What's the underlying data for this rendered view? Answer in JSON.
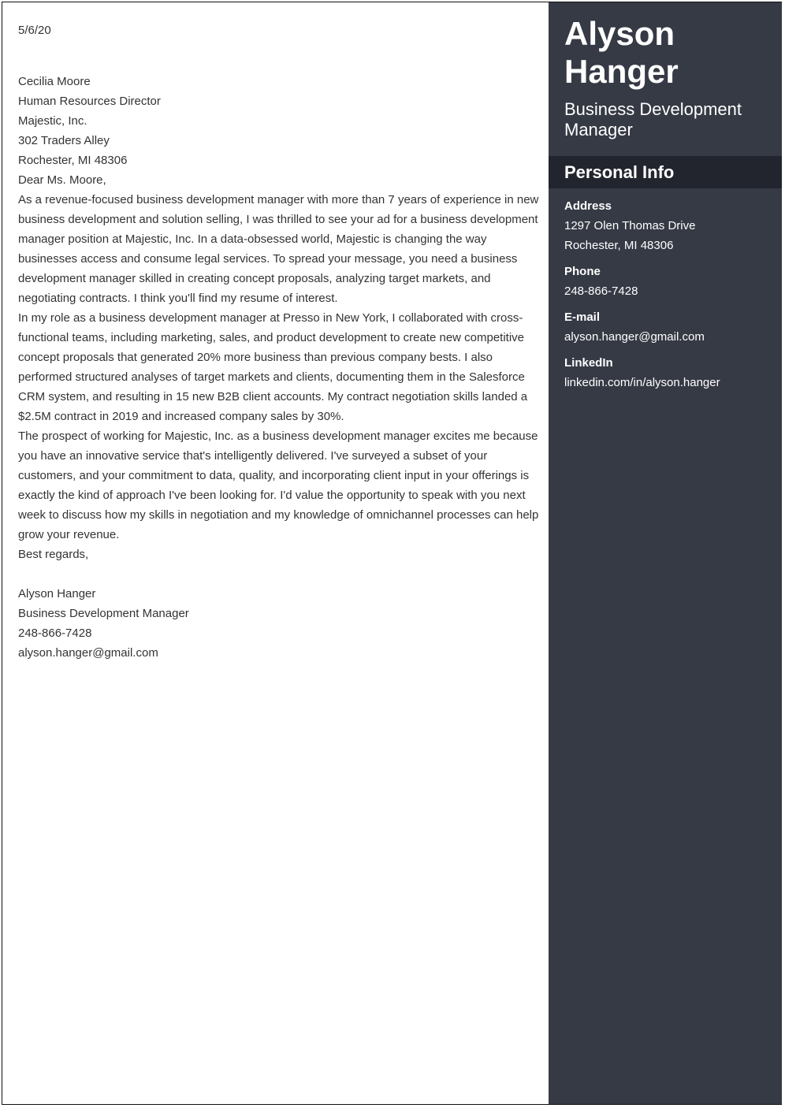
{
  "letter": {
    "date": "5/6/20",
    "recipient": [
      "Cecilia Moore",
      "Human Resources Director",
      "Majestic, Inc.",
      "302 Traders Alley",
      "Rochester, MI 48306"
    ],
    "salutation": "Dear Ms. Moore,",
    "paragraphs": [
      "As a revenue-focused business development manager with more than 7 years of experience in new business development and solution selling, I was thrilled to see your ad for a business development manager position at Majestic, Inc. In a data-obsessed world, Majestic is changing the way businesses access and consume legal services. To spread your message, you need a business development manager skilled in creating concept proposals, analyzing target markets, and negotiating contracts. I think you'll find my resume of interest.",
      "In my role as a business development manager at Presso in New York, I collaborated with cross-functional teams, including marketing, sales, and product development to create new competitive concept proposals that generated 20% more business than previous company bests. I also performed structured analyses of target markets and clients, documenting them in the Salesforce CRM system, and resulting in 15 new B2B client accounts. My contract negotiation skills landed a $2.5M contract in 2019 and increased company sales by 30%.",
      "The prospect of working for Majestic, Inc. as a business development manager excites me because you have an innovative service that's intelligently delivered. I've surveyed a subset of your customers, and your commitment to data, quality, and incorporating client input in your offerings is exactly the kind of approach I've been looking for. I'd value the opportunity to speak with you next week to discuss how my skills in negotiation and my knowledge of omnichannel processes can help grow your revenue."
    ],
    "closing": "Best regards,",
    "signature": [
      "Alyson Hanger",
      "Business Development Manager",
      "248-866-7428",
      "alyson.hanger@gmail.com"
    ]
  },
  "sidebar": {
    "name_first": "Alyson",
    "name_last": "Hanger",
    "job_title": "Business Development Manager",
    "section_title": "Personal Info",
    "address_label": "Address",
    "address_line1": "1297 Olen Thomas Drive",
    "address_line2": "Rochester, MI 48306",
    "phone_label": "Phone",
    "phone": "248-866-7428",
    "email_label": "E-mail",
    "email": "alyson.hanger@gmail.com",
    "linkedin_label": "LinkedIn",
    "linkedin": "linkedin.com/in/alyson.hanger"
  },
  "colors": {
    "sidebar_bg": "#363a45",
    "section_band_bg": "#22252d",
    "body_text": "#333333"
  }
}
